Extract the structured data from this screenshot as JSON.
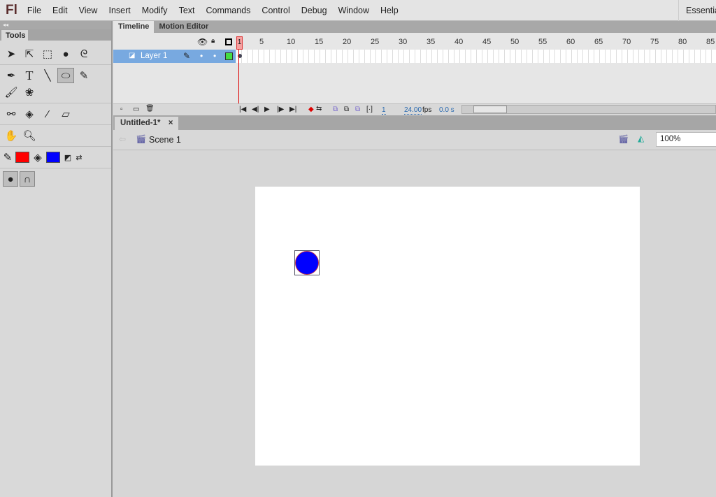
{
  "app": {
    "logo": "Fl",
    "workspace": "Essentials"
  },
  "menu": [
    "File",
    "Edit",
    "View",
    "Insert",
    "Modify",
    "Text",
    "Commands",
    "Control",
    "Debug",
    "Window",
    "Help"
  ],
  "tools": {
    "panel_title": "Tools",
    "collapse": "◂◂",
    "stroke_color": "#ff0000",
    "fill_color": "#0000ff",
    "selected_tool": "oval"
  },
  "timeline": {
    "tabs": [
      "Timeline",
      "Motion Editor"
    ],
    "ruler": [
      "1",
      "5",
      "10",
      "15",
      "20",
      "25",
      "30",
      "35",
      "40",
      "45",
      "50",
      "55",
      "60",
      "65",
      "70",
      "75",
      "80",
      "85"
    ],
    "layer": {
      "name": "Layer 1",
      "color": "#44dd44"
    },
    "current_frame": "1",
    "fps": "24.00",
    "fps_unit": "fps",
    "time": "0.0 s"
  },
  "document": {
    "tab": "Untitled-1*",
    "close": "×",
    "scene": "Scene 1",
    "zoom": "100%"
  },
  "stage": {
    "background": "#ffffff",
    "shape": {
      "type": "circle",
      "fill": "#0000ff",
      "selected": true
    }
  }
}
